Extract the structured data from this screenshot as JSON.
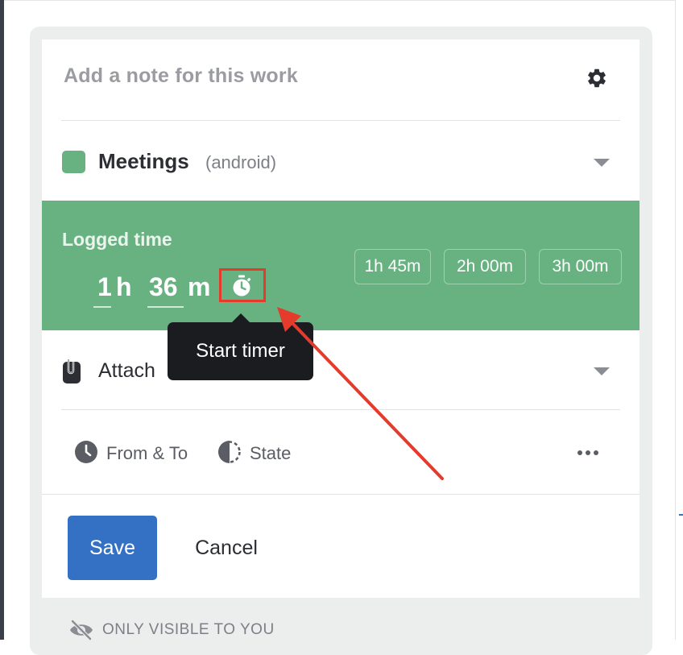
{
  "entry": {
    "note_placeholder": "Add a note for this work",
    "settings_icon": "gear-icon"
  },
  "project": {
    "name": "Meetings",
    "client": "(android)",
    "color": "#67b280"
  },
  "logged_time": {
    "label": "Logged time",
    "hours": "1",
    "hours_unit": "h",
    "minutes": "36",
    "minutes_unit": "m",
    "timer_icon": "stopwatch-icon",
    "presets": [
      "1h 45m",
      "2h 00m",
      "3h 00m"
    ]
  },
  "tooltip": {
    "text": "Start timer"
  },
  "attach": {
    "label": "Attach"
  },
  "options": {
    "from_to_label": "From & To",
    "state_label": "State"
  },
  "actions": {
    "save_label": "Save",
    "cancel_label": "Cancel"
  },
  "visibility": {
    "text": "ONLY VISIBLE TO YOU"
  },
  "colors": {
    "accent_green": "#67b280",
    "save_blue": "#3471c4",
    "annotation_red": "#e53b2d"
  }
}
